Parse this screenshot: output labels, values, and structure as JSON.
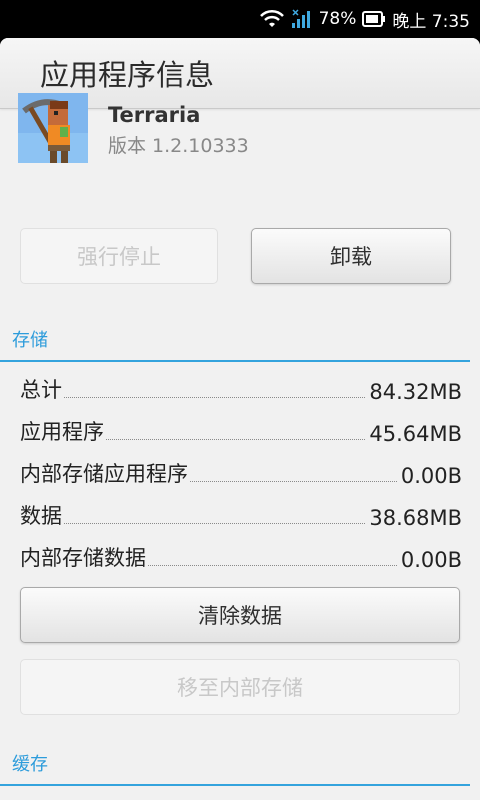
{
  "status_bar": {
    "battery": "78%",
    "time": "晚上 7:35"
  },
  "title": "应用程序信息",
  "app": {
    "name": "Terraria",
    "version": "版本 1.2.10333"
  },
  "buttons": {
    "force_stop": "强行停止",
    "uninstall": "卸载",
    "clear_data": "清除数据",
    "move_to_internal": "移至内部存储"
  },
  "storage": {
    "header": "存储",
    "rows": [
      {
        "label": "总计",
        "value": "84.32MB"
      },
      {
        "label": "应用程序",
        "value": "45.64MB"
      },
      {
        "label": "内部存储应用程序",
        "value": "0.00B"
      },
      {
        "label": "数据",
        "value": "38.68MB"
      },
      {
        "label": "内部存储数据",
        "value": "0.00B"
      }
    ]
  },
  "cache": {
    "header": "缓存"
  },
  "colors": {
    "accent": "#34a3dd"
  }
}
